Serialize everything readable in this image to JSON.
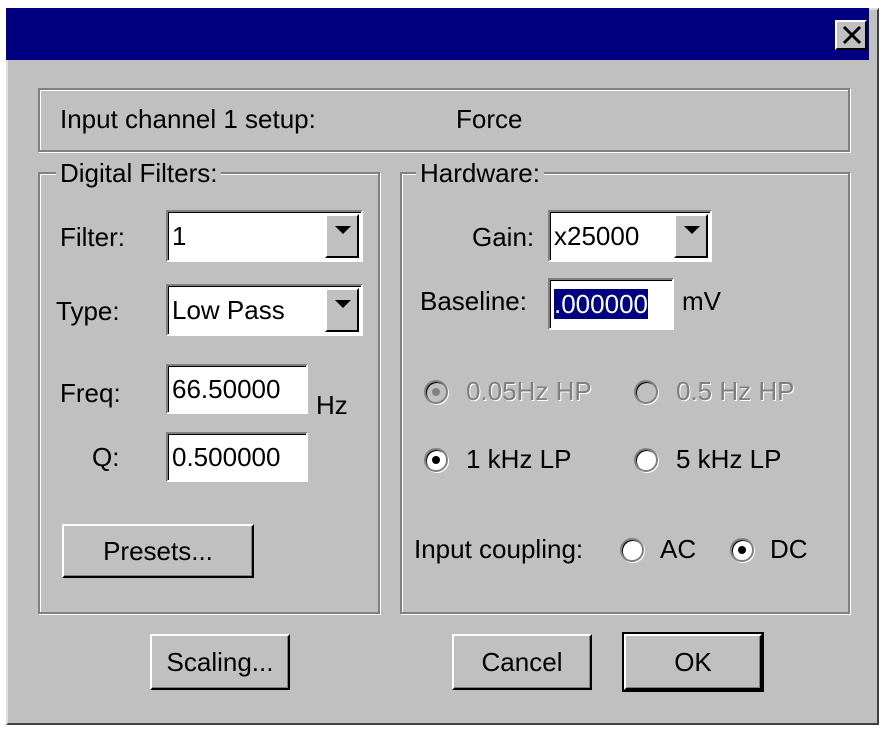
{
  "window": {
    "close_label": "✕"
  },
  "header": {
    "label": "Input channel 1 setup:",
    "channel_name": "Force"
  },
  "digital_filters": {
    "title": "Digital Filters:",
    "filter_label": "Filter:",
    "filter_value": "1",
    "type_label": "Type:",
    "type_value": "Low Pass",
    "freq_label": "Freq:",
    "freq_value": "66.50000",
    "freq_unit": "Hz",
    "q_label": "Q:",
    "q_value": "0.500000",
    "presets_label": "Presets..."
  },
  "hardware": {
    "title": "Hardware:",
    "gain_label": "Gain:",
    "gain_value": "x25000",
    "baseline_label": "Baseline:",
    "baseline_value": ".000000",
    "baseline_unit": "mV",
    "hp_options": [
      {
        "label": "0.05Hz HP",
        "selected": true,
        "enabled": false
      },
      {
        "label": "0.5 Hz HP",
        "selected": false,
        "enabled": false
      }
    ],
    "lp_options": [
      {
        "label": "1 kHz LP",
        "selected": true,
        "enabled": true
      },
      {
        "label": "5 kHz LP",
        "selected": false,
        "enabled": true
      }
    ],
    "coupling_label": "Input coupling:",
    "coupling_options": [
      {
        "label": "AC",
        "selected": false
      },
      {
        "label": "DC",
        "selected": true
      }
    ]
  },
  "footer": {
    "scaling_label": "Scaling...",
    "cancel_label": "Cancel",
    "ok_label": "OK"
  },
  "colors": {
    "titlebar": "#000080",
    "face": "#c0c0c0",
    "selection": "#000080"
  }
}
